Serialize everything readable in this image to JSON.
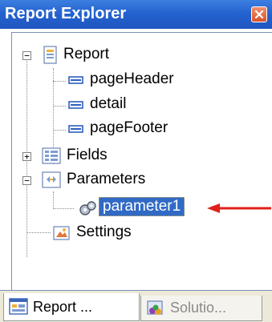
{
  "window": {
    "title": "Report Explorer",
    "close_icon": "close-icon"
  },
  "tree": {
    "items": [
      {
        "label": "Report",
        "expander": "−",
        "icon": "report-icon"
      },
      {
        "label": "pageHeader",
        "icon": "section-icon"
      },
      {
        "label": "detail",
        "icon": "section-icon"
      },
      {
        "label": "pageFooter",
        "icon": "section-icon"
      },
      {
        "label": "Fields",
        "expander": "+",
        "icon": "fields-icon"
      },
      {
        "label": "Parameters",
        "expander": "−",
        "icon": "parameters-icon"
      },
      {
        "label": "parameter1",
        "icon": "parameter-icon",
        "selected": true
      },
      {
        "label": "Settings",
        "icon": "settings-icon"
      }
    ]
  },
  "tabs": [
    {
      "label": "Report ...",
      "active": true,
      "icon": "report-explorer-tab-icon"
    },
    {
      "label": "Solutio...",
      "active": false,
      "icon": "solution-explorer-tab-icon"
    }
  ],
  "colors": {
    "title_bar": "#2563d0",
    "selection": "#316ac5",
    "arrow": "#e0201a"
  }
}
